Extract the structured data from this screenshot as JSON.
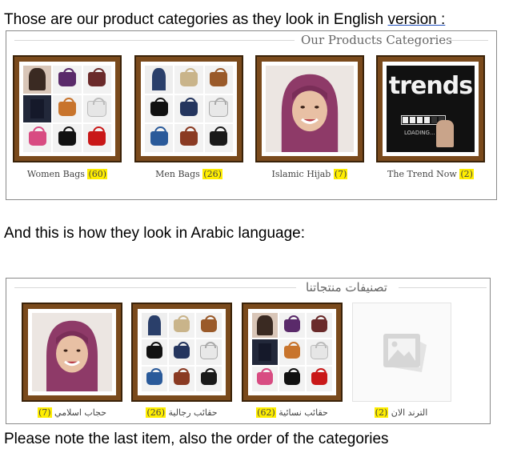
{
  "captions": {
    "top": "Those are our product categories as they look in English ",
    "top_link": "version :",
    "middle": "And this is how they look in Arabic language:",
    "bottom": "Please note the last item, also the order of the categories"
  },
  "english": {
    "title": "Our Products Categories",
    "items": [
      {
        "name": "Women Bags",
        "count": "(60)"
      },
      {
        "name": "Men Bags",
        "count": "(26)"
      },
      {
        "name": "Islamic Hijab",
        "count": "(7)"
      },
      {
        "name": "The Trend Now",
        "count": "(2)"
      }
    ],
    "trends_word": "trends",
    "trends_sub": "LOADING..."
  },
  "arabic": {
    "title": "تصنيفات منتجاتنا",
    "items": [
      {
        "name": "حجاب اسلامي",
        "count": "(7)"
      },
      {
        "name": "حقائب رجالية",
        "count": "(26)"
      },
      {
        "name": "حقائب نسائية",
        "count": "(62)"
      },
      {
        "name": "الترند الان",
        "count": "(2)"
      }
    ]
  },
  "colors": {
    "frame": "#7a4a1c",
    "highlight": "#ffee00",
    "hijab": "#8e3a68"
  }
}
